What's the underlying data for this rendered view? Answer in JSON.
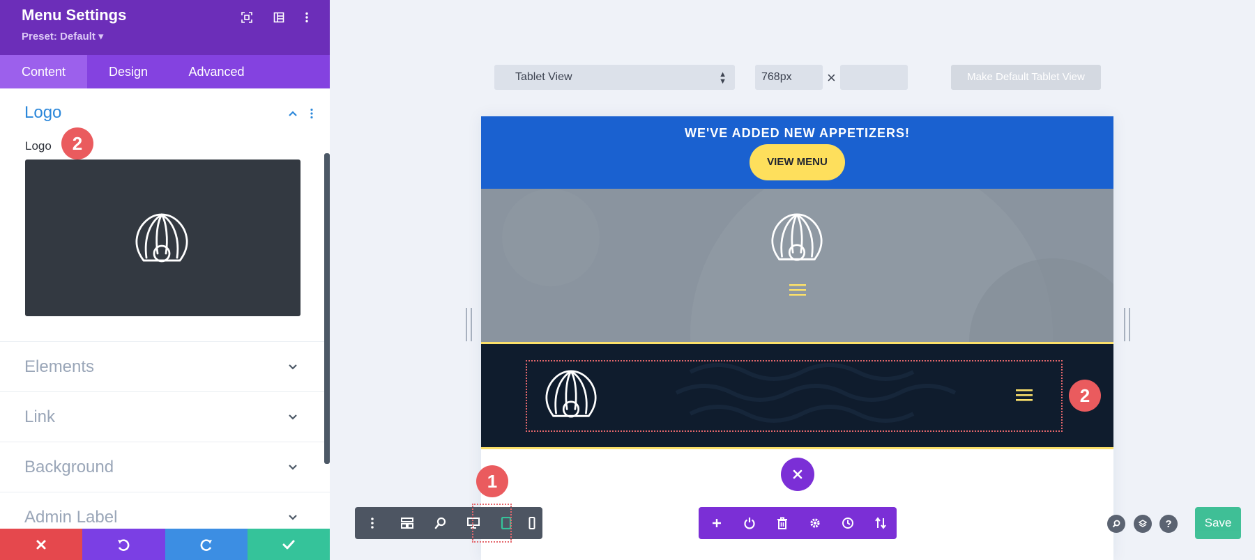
{
  "panel": {
    "title": "Menu Settings",
    "preset": "Preset: Default ▾",
    "tabs": [
      {
        "label": "Content",
        "active": true
      },
      {
        "label": "Design",
        "active": false
      },
      {
        "label": "Advanced",
        "active": false
      }
    ],
    "logo_section": {
      "title": "Logo",
      "field_label": "Logo"
    },
    "sections": [
      "Elements",
      "Link",
      "Background",
      "Admin Label"
    ]
  },
  "badges": {
    "logo_field": "2",
    "preview_header": "2",
    "tablet_button": "1"
  },
  "toolbar": {
    "view_select": "Tablet View",
    "width_value": "768px",
    "height_value": "",
    "make_default_label": "Make Default Tablet View"
  },
  "preview": {
    "announcement": "WE'VE ADDED NEW APPETIZERS!",
    "view_menu_label": "VIEW MENU"
  },
  "footer": {
    "save_label": "Save"
  },
  "colors": {
    "panel_header": "#6c2eb9",
    "tabs_bar": "#8442e0",
    "accent_blue": "#2b87da",
    "announcement_bg": "#1a61d0",
    "button_yellow": "#fedf5c",
    "badge_red": "#ea5b5e",
    "save_green": "#2dba8c",
    "cancel_red": "#e5484d",
    "undo_purple": "#7b3fe4",
    "redo_blue": "#3c8ee3",
    "confirm_teal": "#35c39a"
  },
  "icons": {
    "header": [
      "expand-icon",
      "layout-icon",
      "more-icon"
    ],
    "bottom_left": [
      "more-vertical-icon",
      "wireframe-icon",
      "zoom-icon",
      "desktop-icon",
      "tablet-icon",
      "phone-icon"
    ],
    "bottom_mid": [
      "add-icon",
      "power-icon",
      "trash-icon",
      "settings-icon",
      "history-icon",
      "portability-icon"
    ],
    "right_tools": [
      "search-icon",
      "layers-icon",
      "help-icon"
    ]
  }
}
